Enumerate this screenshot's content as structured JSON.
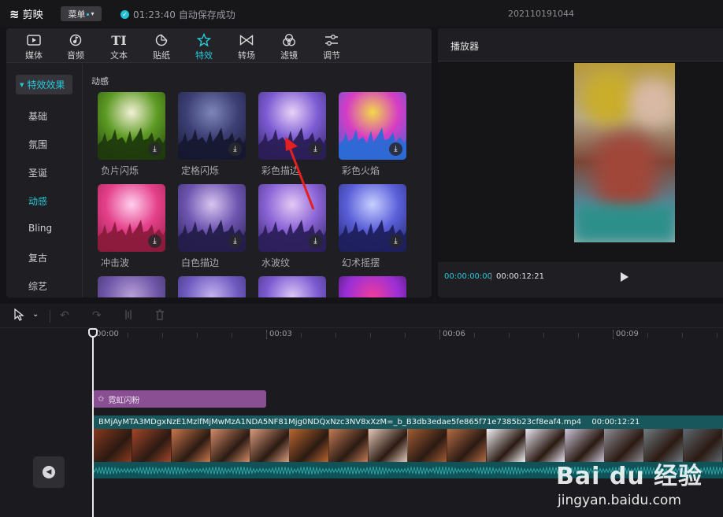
{
  "app": {
    "name": "剪映",
    "menu_label": "菜单",
    "save_status": "01:23:40 自动保存成功",
    "project_name": "202110191044"
  },
  "toolbar": {
    "tools": [
      {
        "label": "媒体",
        "icon": "media-icon"
      },
      {
        "label": "音频",
        "icon": "audio-icon"
      },
      {
        "label": "文本",
        "icon": "text-icon"
      },
      {
        "label": "贴纸",
        "icon": "sticker-icon"
      },
      {
        "label": "特效",
        "icon": "effects-icon",
        "active": true
      },
      {
        "label": "转场",
        "icon": "transition-icon"
      },
      {
        "label": "滤镜",
        "icon": "filter-icon"
      },
      {
        "label": "调节",
        "icon": "adjust-icon"
      }
    ]
  },
  "categories": {
    "header": "特效效果",
    "items": [
      "基础",
      "氛围",
      "圣诞",
      "动感",
      "Bling",
      "复古",
      "综艺"
    ],
    "active": "动感"
  },
  "effects": {
    "section_title": "动感",
    "items": [
      {
        "name": "负片闪烁",
        "palette": [
          "#f4f0d6",
          "#5c9a23",
          "#1f3a0d"
        ]
      },
      {
        "name": "定格闪烁",
        "palette": [
          "#7e86b8",
          "#3c3f74",
          "#161830"
        ]
      },
      {
        "name": "彩色描边",
        "palette": [
          "#e9d2f7",
          "#7c5bd3",
          "#2a1e55"
        ]
      },
      {
        "name": "彩色火焰",
        "palette": [
          "#f2d94a",
          "#d63cc5",
          "#2a6ad6"
        ]
      },
      {
        "name": "冲击波",
        "palette": [
          "#ffd0ef",
          "#e4408a",
          "#8a1a3c"
        ]
      },
      {
        "name": "白色描边",
        "palette": [
          "#d9c5f0",
          "#6d55b0",
          "#241c4a"
        ]
      },
      {
        "name": "水波纹",
        "palette": [
          "#e3c9f5",
          "#8a63d6",
          "#2b1f5a"
        ]
      },
      {
        "name": "幻术摇摆",
        "palette": [
          "#c8d0ff",
          "#5a5fd9",
          "#1d1f5c"
        ]
      },
      {
        "name": "",
        "palette": [
          "#b9a2d8",
          "#6f56a8",
          "#2a1f4c"
        ]
      },
      {
        "name": "",
        "palette": [
          "#c6b3ef",
          "#6f5bc0",
          "#2a2156"
        ]
      },
      {
        "name": "",
        "palette": [
          "#dcc8f7",
          "#7c5ad1",
          "#2c2159"
        ]
      },
      {
        "name": "",
        "palette": [
          "#f03c9c",
          "#9b2fd6",
          "#1c0f35"
        ]
      }
    ]
  },
  "player": {
    "title": "播放器",
    "current_time": "00:00:00:00",
    "total_time": "00:00:12:21"
  },
  "timeline": {
    "ruler": [
      "00:00",
      "00:03",
      "00:06",
      "00:09"
    ],
    "effect_clip": "霓虹闪粉",
    "video_clip": {
      "filename": "BMjAyMTA3MDgxNzE1MzlfMjMwMzA1NDA5NF81Mjg0NDQxNzc3NV8xXzM=_b_B3db3edae5fe865f71e7385b23cf8eaf4.mp4",
      "duration": "00:00:12:21",
      "frame_colors": [
        "#8a3a1e",
        "#a4452a",
        "#c9764c",
        "#d28a68",
        "#d99a7d",
        "#b9652f",
        "#c07a55",
        "#e3c8b8",
        "#a15b34",
        "#b26b44",
        "#f0f0f4",
        "#e6e2ee",
        "#c9c3d6",
        "#8c8c94",
        "#6f7a80",
        "#5e6870"
      ]
    }
  },
  "watermark": {
    "brand": "Bai du 经验",
    "site": "jingyan.baidu.com"
  }
}
